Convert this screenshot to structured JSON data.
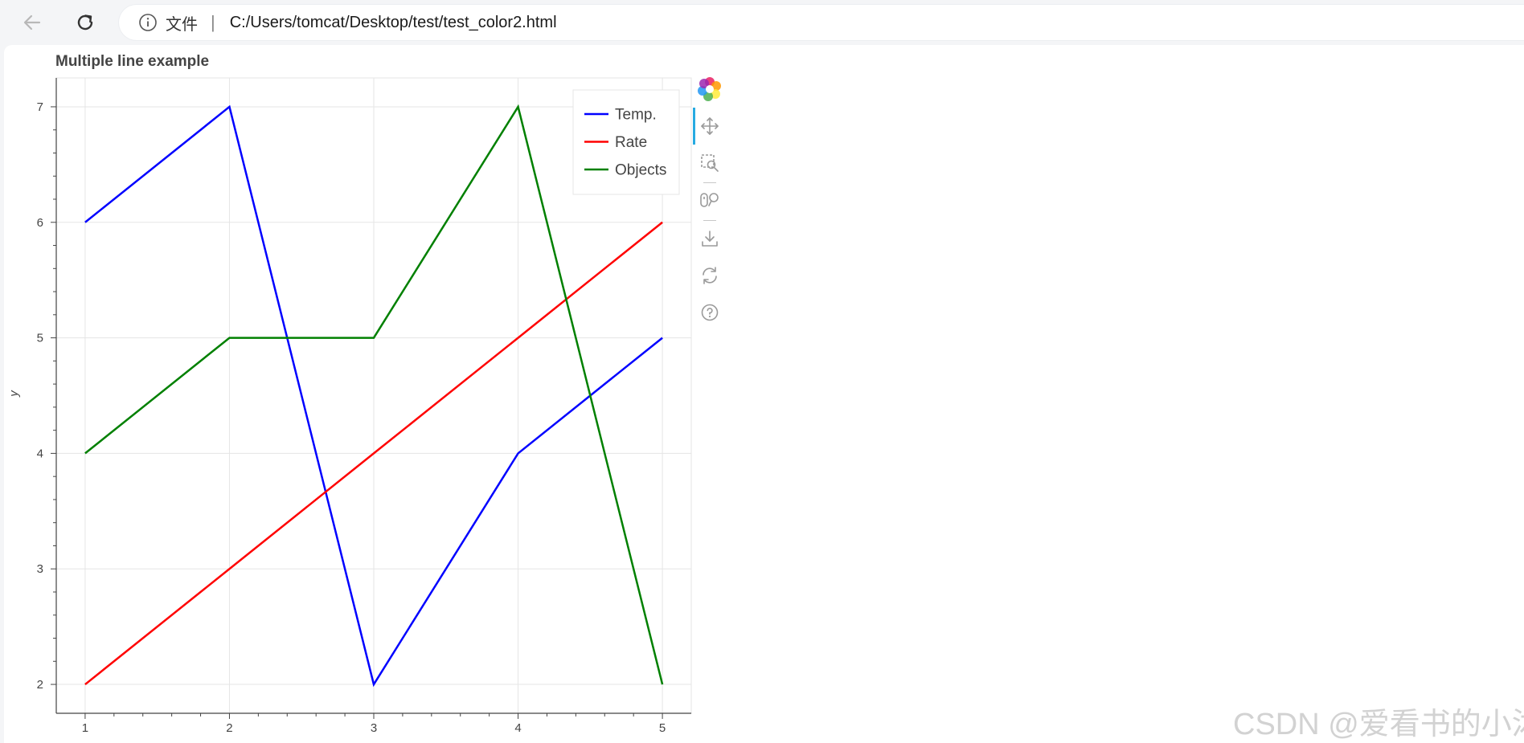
{
  "browser": {
    "protocol_label": "文件",
    "separator": "|",
    "url": "C:/Users/tomcat/Desktop/test/test_color2.html"
  },
  "plot": {
    "title": "Multiple line example",
    "ylabel": "y"
  },
  "toolbar": {
    "tools": [
      "bokeh-logo",
      "pan-icon",
      "box-zoom-icon",
      "wheel-zoom-icon",
      "save-icon",
      "reset-icon",
      "help-icon"
    ]
  },
  "colors": {
    "temp": "#0000ff",
    "rate": "#ff0000",
    "objects": "#008000",
    "grid": "#e5e5e5",
    "axis": "#444444"
  },
  "chart_data": {
    "type": "line",
    "title": "Multiple line example",
    "xlabel": "",
    "ylabel": "y",
    "x": [
      1,
      2,
      3,
      4,
      5
    ],
    "xlim": [
      0.8,
      5.2
    ],
    "ylim": [
      1.75,
      7.25
    ],
    "xticks": [
      1,
      2,
      3,
      4,
      5
    ],
    "yticks": [
      2,
      3,
      4,
      5,
      6,
      7
    ],
    "grid": true,
    "legend_position": "top-right",
    "series": [
      {
        "name": "Temp.",
        "color": "#0000ff",
        "values": [
          6,
          7,
          2,
          4,
          5
        ]
      },
      {
        "name": "Rate",
        "color": "#ff0000",
        "values": [
          2,
          3,
          4,
          5,
          6
        ]
      },
      {
        "name": "Objects",
        "color": "#008000",
        "values": [
          4,
          5,
          5,
          7,
          2
        ]
      }
    ]
  },
  "watermark": "CSDN @爱看书的小沐"
}
